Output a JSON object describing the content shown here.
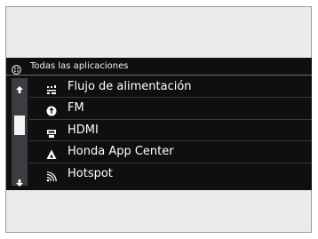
{
  "header": {
    "title": "Todas las aplicaciones",
    "icon": "apps-grid-icon"
  },
  "scrollbar": {
    "up_icon": "scroll-up-icon",
    "down_icon": "scroll-down-icon"
  },
  "apps": [
    {
      "label": "Flujo de alimentación",
      "icon": "feed-icon"
    },
    {
      "label": "FM",
      "icon": "radio-icon"
    },
    {
      "label": "HDMI",
      "icon": "hdmi-icon"
    },
    {
      "label": "Honda App Center",
      "icon": "app-center-icon"
    },
    {
      "label": "Hotspot",
      "icon": "wifi-hotspot-icon"
    }
  ],
  "colors": {
    "screen_background": "#0f0f10",
    "frame_background": "#ebebeb",
    "scrollbar_background": "#3b3d42",
    "text": "#ffffff"
  }
}
